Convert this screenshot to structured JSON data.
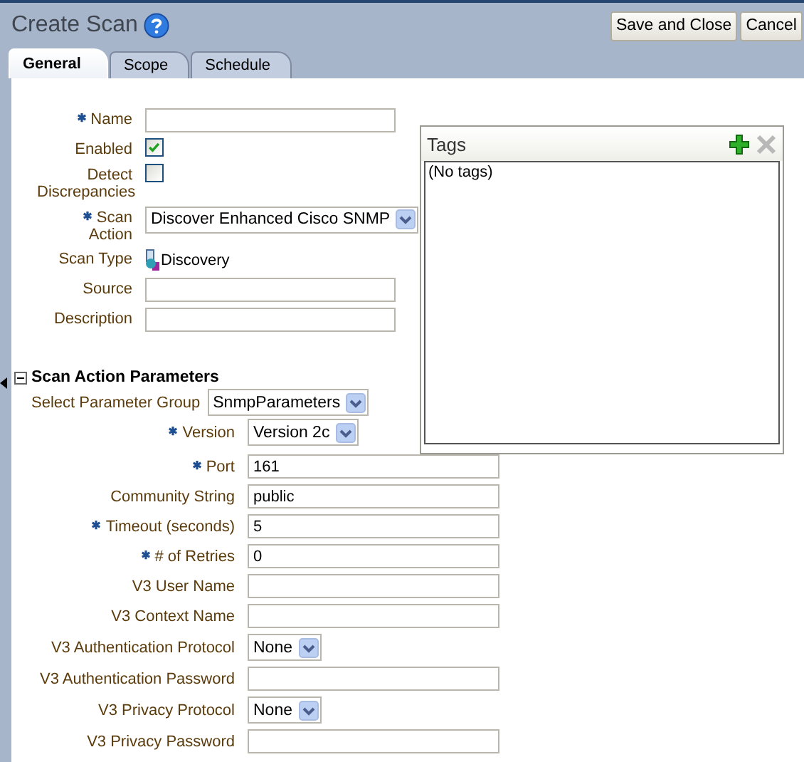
{
  "header": {
    "title": "Create Scan",
    "buttons": [
      "Save and Close",
      "Cancel"
    ]
  },
  "tabs": [
    {
      "label": "General",
      "selected": true
    },
    {
      "label": "Scope",
      "selected": false
    },
    {
      "label": "Schedule",
      "selected": false
    }
  ],
  "general_fields": [
    {
      "kind": "text",
      "label": "Name",
      "required": true
    },
    {
      "kind": "checkbox",
      "label": "Enabled",
      "required": false,
      "checked": true
    },
    {
      "kind": "checkbox",
      "label": "Detect Discrepancies",
      "required": false,
      "checked": false
    },
    {
      "kind": "select",
      "label": "Scan Action",
      "required": true,
      "value": "Discover Enhanced Cisco SNMP"
    },
    {
      "kind": "type",
      "label": "Scan Type",
      "required": false,
      "value": "Discovery"
    },
    {
      "kind": "text",
      "label": "Source",
      "required": false
    },
    {
      "kind": "text",
      "label": "Description",
      "required": false
    }
  ],
  "tags": {
    "title": "Tags",
    "empty_text": "(No tags)"
  },
  "parameters": {
    "title": "Scan Action Parameters",
    "expanded": true,
    "group": {
      "label": "Select Parameter Group",
      "value": "SnmpParameters"
    },
    "fields": [
      {
        "kind": "select",
        "label": "Version",
        "required": true,
        "value": "Version 2c"
      },
      {
        "kind": "text",
        "label": "Port",
        "required": true,
        "value": "161"
      },
      {
        "kind": "text",
        "label": "Community String",
        "required": false,
        "value": "public"
      },
      {
        "kind": "text",
        "label": "Timeout (seconds)",
        "required": true,
        "value": "5"
      },
      {
        "kind": "text",
        "label": "# of Retries",
        "required": true,
        "value": "0"
      },
      {
        "kind": "text",
        "label": "V3 User Name",
        "required": false
      },
      {
        "kind": "text",
        "label": "V3 Context Name",
        "required": false
      },
      {
        "kind": "select",
        "label": "V3 Authentication Protocol",
        "required": false,
        "value": "None"
      },
      {
        "kind": "text",
        "label": "V3 Authentication Password",
        "required": false
      },
      {
        "kind": "select",
        "label": "V3 Privacy Protocol",
        "required": false,
        "value": "None"
      },
      {
        "kind": "text",
        "label": "V3 Privacy Password",
        "required": false
      }
    ]
  }
}
